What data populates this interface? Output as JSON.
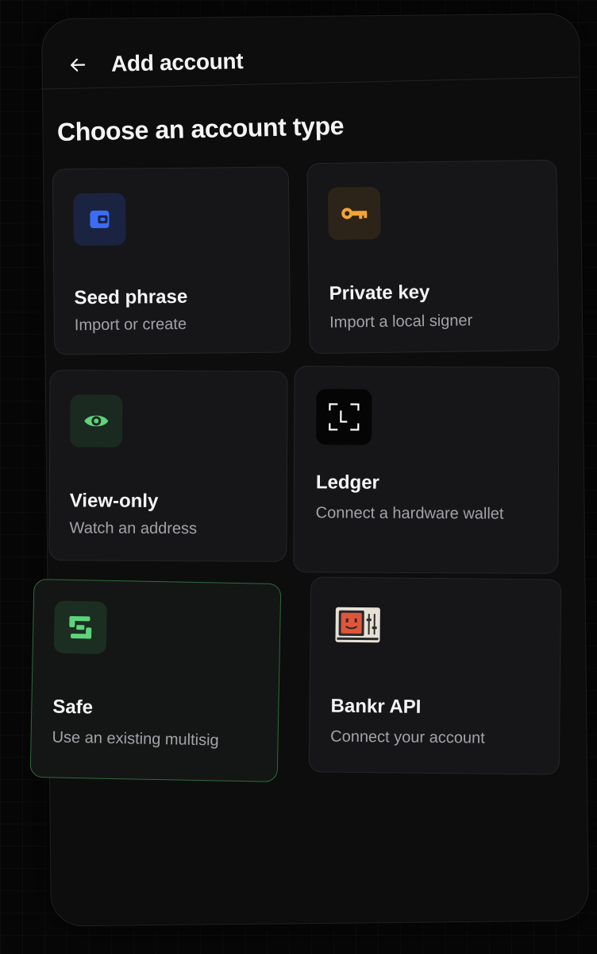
{
  "header": {
    "back_icon": "arrow-left-icon",
    "title": "Add account"
  },
  "section_title": "Choose an account type",
  "cards": [
    {
      "title": "Seed phrase",
      "subtitle": "Import or create",
      "icon": "wallet-icon",
      "icon_color": "#3b6cf5",
      "icon_bg": "#1a2340"
    },
    {
      "title": "Private key",
      "subtitle": "Import a local signer",
      "icon": "key-icon",
      "icon_color": "#f2a33a",
      "icon_bg": "#2c2418"
    },
    {
      "title": "View-only",
      "subtitle": "Watch an address",
      "icon": "eye-icon",
      "icon_color": "#5fd37b",
      "icon_bg": "#1b2a20"
    },
    {
      "title": "Ledger",
      "subtitle": "Connect a hardware wallet",
      "icon": "ledger-icon",
      "icon_color": "#ffffff",
      "icon_bg": "#050505"
    },
    {
      "title": "Safe",
      "subtitle": "Use an existing multisig",
      "icon": "safe-icon",
      "icon_color": "#5fd37b",
      "icon_bg": "#1c2e22",
      "highlight_color": "#2f6a3d"
    },
    {
      "title": "Bankr API",
      "subtitle": "Connect your account",
      "icon": "bankr-robot-icon",
      "icon_color": "#e0553a",
      "icon_bg": "transparent"
    }
  ]
}
